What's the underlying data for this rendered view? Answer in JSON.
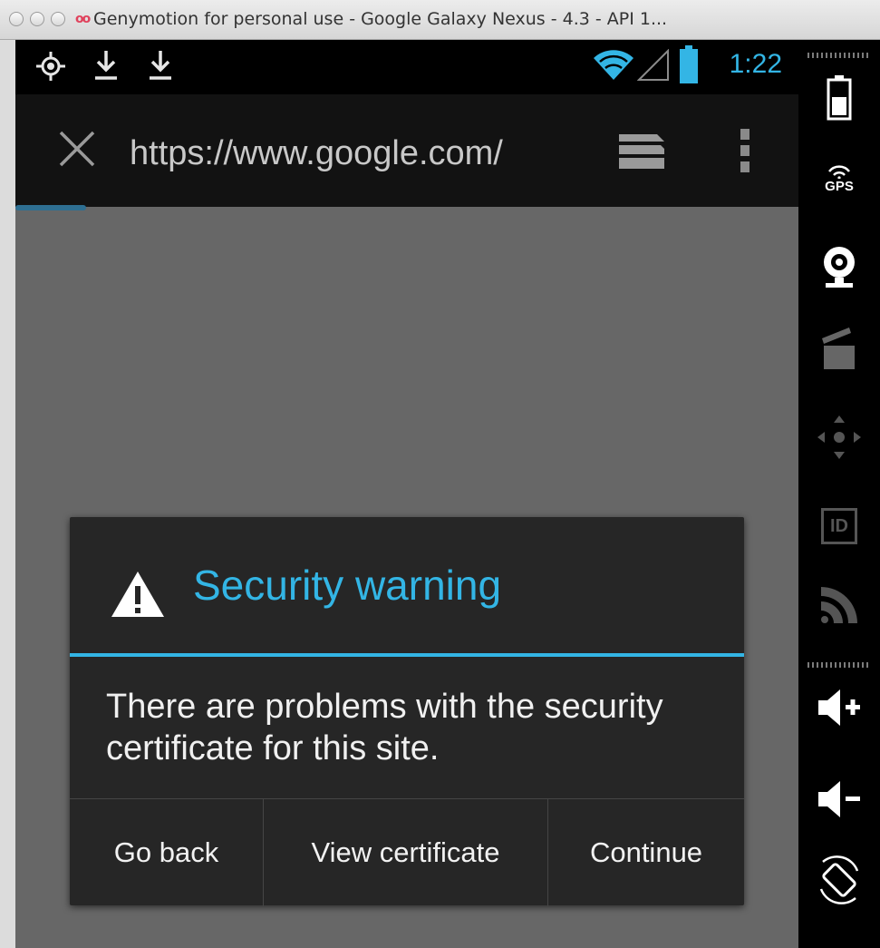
{
  "window": {
    "title": "Genymotion for personal use - Google Galaxy Nexus - 4.3 - API 1...",
    "logo_glyph": "oo"
  },
  "statusbar": {
    "time": "1:22",
    "accent_color": "#33b5e5",
    "icons": [
      "gps-icon",
      "download-icon",
      "download-icon",
      "wifi-icon",
      "signal-icon",
      "battery-icon"
    ]
  },
  "browser": {
    "url": "https://www.google.com/",
    "icons": [
      "close-icon",
      "tabs-icon",
      "overflow-menu-icon"
    ]
  },
  "dialog": {
    "title": "Security warning",
    "message": "There are problems with the security certificate for this site.",
    "buttons": {
      "go_back": "Go back",
      "view_certificate": "View certificate",
      "continue": "Continue"
    },
    "title_color": "#33b5e5"
  },
  "sidepanel": {
    "gps_label": "GPS",
    "id_label": "ID",
    "tools": [
      "battery-icon",
      "gps-icon",
      "webcam-icon",
      "screencast-icon",
      "remote-control-icon",
      "device-id-icon",
      "network-icon",
      "volume-up-icon",
      "volume-down-icon",
      "rotate-icon"
    ]
  }
}
